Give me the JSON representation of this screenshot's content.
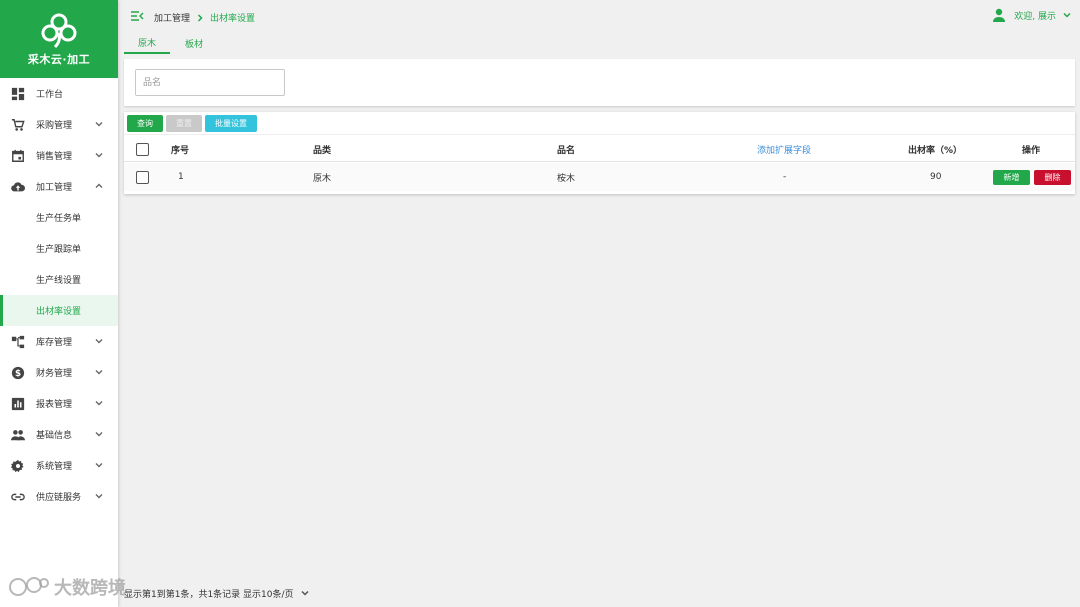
{
  "app": {
    "brand_name": "采木云·加工",
    "brand_color": "#22a84b"
  },
  "sidebar": {
    "items": [
      {
        "label": "工作台",
        "icon": "dashboard-icon"
      },
      {
        "label": "采购管理",
        "icon": "cart-icon"
      },
      {
        "label": "销售管理",
        "icon": "calendar-icon"
      },
      {
        "label": "加工管理",
        "icon": "cloud-upload-icon"
      },
      {
        "label": "库存管理",
        "icon": "tree-structure-icon"
      },
      {
        "label": "财务管理",
        "icon": "dollar-icon"
      },
      {
        "label": "报表管理",
        "icon": "bar-chart-icon"
      },
      {
        "label": "基础信息",
        "icon": "people-icon"
      },
      {
        "label": "系统管理",
        "icon": "gear-icon"
      },
      {
        "label": "供应链服务",
        "icon": "link-icon"
      }
    ],
    "sub_items": [
      {
        "label": "生产任务单"
      },
      {
        "label": "生产跟踪单"
      },
      {
        "label": "生产线设置"
      },
      {
        "label": "出材率设置"
      }
    ]
  },
  "header": {
    "breadcrumb_root": "加工管理",
    "breadcrumb_current": "出材率设置",
    "user_text": "欢迎, 展示"
  },
  "tabs": [
    {
      "label": "原木"
    },
    {
      "label": "板材"
    }
  ],
  "search": {
    "placeholder": "品名"
  },
  "toolbar": {
    "query_label": "查询",
    "reset_label": "重置",
    "batch_label": "批量设置"
  },
  "table": {
    "columns": [
      "序号",
      "品类",
      "品名",
      "添加扩展字段",
      "出材率（%）",
      "操作"
    ],
    "rows": [
      {
        "index": "1",
        "category": "原木",
        "name": "桉木",
        "ext": "-",
        "rate": "90",
        "add_label": "新增",
        "delete_label": "删除"
      }
    ]
  },
  "pagination": {
    "text": "显示第1到第1条，共1条记录 显示10条/页"
  },
  "watermark": {
    "text": "大数跨境"
  }
}
